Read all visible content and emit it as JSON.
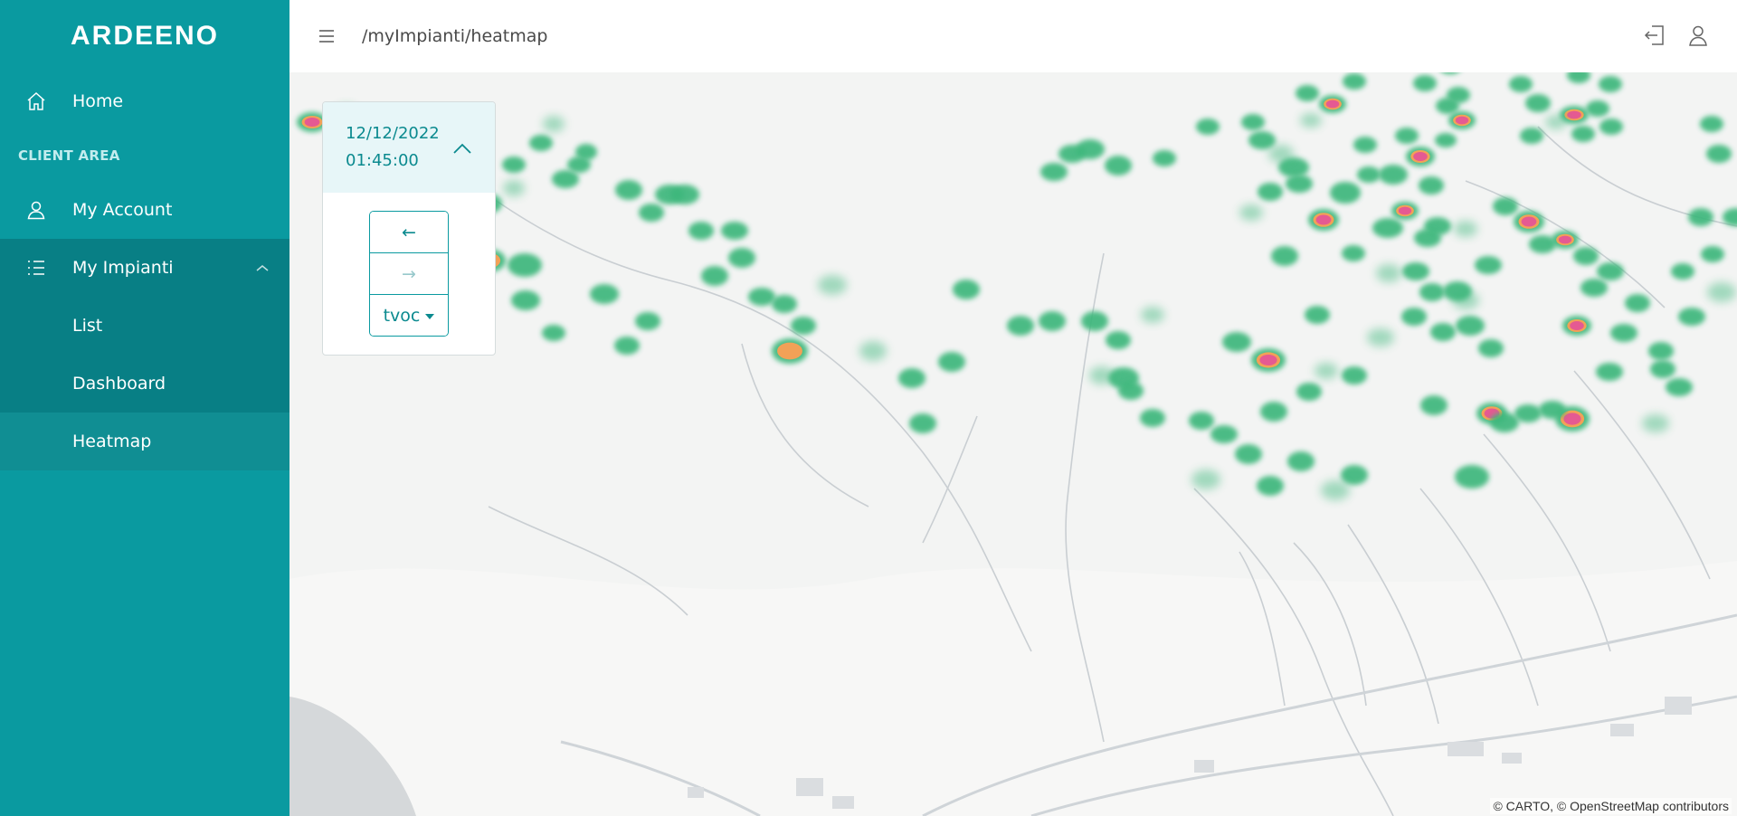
{
  "app": {
    "brand": "ARDEENO",
    "path": "/myImpianti/heatmap"
  },
  "colors": {
    "sidebar": "#0a9aa0",
    "accent": "#0b8a8f",
    "heat_low": "#3cb77c",
    "heat_mid": "#f29a4a",
    "heat_high": "#e44d8a"
  },
  "sidebar": {
    "home": {
      "label": "Home",
      "icon": "home-icon"
    },
    "section_label": "CLIENT AREA",
    "account": {
      "label": "My Account",
      "icon": "user-icon"
    },
    "impianti": {
      "label": "My Impianti",
      "icon": "list-icon",
      "expanded": true,
      "children": [
        {
          "label": "List"
        },
        {
          "label": "Dashboard"
        },
        {
          "label": "Heatmap",
          "current": true
        }
      ]
    }
  },
  "topbar": {
    "menu_icon": "hamburger-icon",
    "logout_icon": "logout-icon",
    "profile_icon": "user-icon"
  },
  "time_panel": {
    "date": "12/12/2022",
    "time": "01:45:00",
    "prev_label": "←",
    "next_label": "→",
    "metric": "tvoc"
  },
  "map": {
    "attribution": "© CARTO, © OpenStreetMap contributors"
  }
}
